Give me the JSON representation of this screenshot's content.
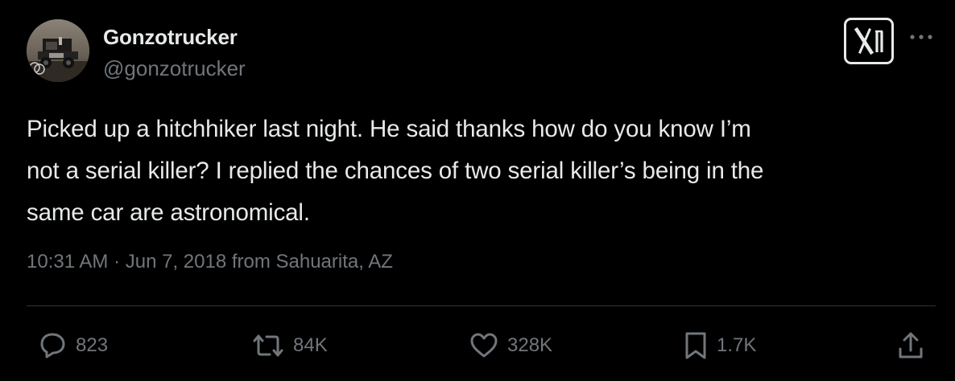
{
  "author": {
    "display_name": "Gonzotrucker",
    "handle": "@gonzotrucker"
  },
  "tweet": {
    "text": "Picked up a hitchhiker last night. He said thanks how do you know I’m\nnot a serial killer? I replied the chances of two serial killer’s being in the\nsame car are astronomical.",
    "meta": "10:31 AM · Jun 7, 2018 from Sahuarita, AZ"
  },
  "actions": {
    "replies": "823",
    "retweets": "84K",
    "likes": "328K",
    "bookmarks": "1.7K"
  },
  "icons": {
    "brand": "x-logo-icon",
    "more": "more-dots-icon",
    "reply": "reply-icon",
    "retweet": "retweet-icon",
    "like": "heart-icon",
    "bookmark": "bookmark-icon",
    "share": "share-icon"
  },
  "colors": {
    "background": "#000000",
    "primary_text": "#e7e9ea",
    "secondary_text": "#71767b",
    "divider": "#2f3336"
  }
}
